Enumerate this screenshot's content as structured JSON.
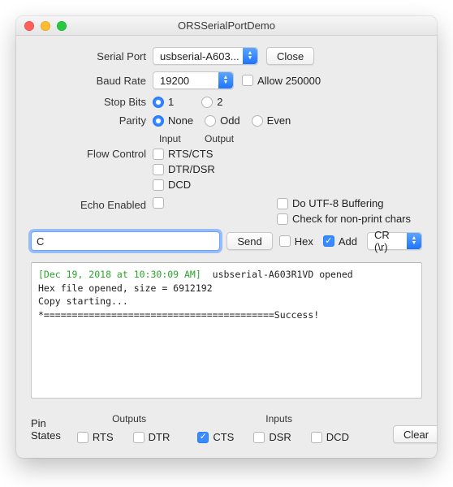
{
  "window": {
    "title": "ORSSerialPortDemo"
  },
  "labels": {
    "serial_port": "Serial Port",
    "baud_rate": "Baud Rate",
    "stop_bits": "Stop Bits",
    "parity": "Parity",
    "flow_control": "Flow Control",
    "echo_enabled": "Echo Enabled",
    "input": "Input",
    "output": "Output",
    "pin_states": "Pin States",
    "outputs": "Outputs",
    "inputs": "Inputs"
  },
  "serial_port": {
    "value": "usbserial-A603..."
  },
  "close_btn": "Close",
  "baud_rate": {
    "value": "19200"
  },
  "allow_250000": "Allow 250000",
  "stop_bits": {
    "opt1": "1",
    "opt2": "2"
  },
  "parity": {
    "none": "None",
    "odd": "Odd",
    "even": "Even"
  },
  "flow": {
    "rtscts": "RTS/CTS",
    "dtrdsr": "DTR/DSR",
    "dcd": "DCD"
  },
  "opts": {
    "utf8": "Do UTF-8 Buffering",
    "nonprint": "Check for non-print chars",
    "hex": "Hex",
    "add": "Add"
  },
  "line_ending": {
    "value": "CR (\\r)"
  },
  "command": {
    "value": "C"
  },
  "send_btn": "Send",
  "clear_btn": "Clear",
  "pins": {
    "rts": "RTS",
    "dtr": "DTR",
    "cts": "CTS",
    "dsr": "DSR",
    "dcd": "DCD"
  },
  "log": {
    "timestamp": "[Dec 19, 2018 at 10:30:09 AM]",
    "line1": "  usbserial-A603R1VD opened",
    "line2": "Hex file opened, size = 6912192",
    "line3": "Copy starting...",
    "line4": "*=========================================Success!"
  }
}
